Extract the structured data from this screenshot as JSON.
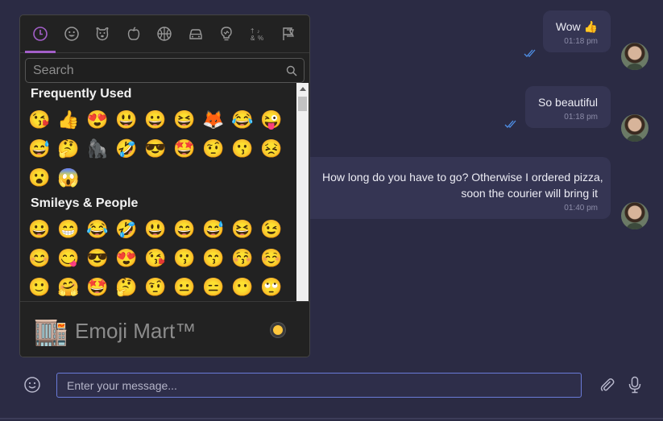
{
  "messages": [
    {
      "text": "Wow 👍",
      "time": "01:18 pm"
    },
    {
      "text": "So beautiful",
      "time": "01:18 pm"
    },
    {
      "line1": "How long do you have to go? Otherwise I ordered pizza,",
      "line2": "soon the courier will bring it",
      "time": "01:40 pm"
    }
  ],
  "picker": {
    "categories": [
      "recent-icon",
      "smileys-icon",
      "animals-icon",
      "food-icon",
      "activity-icon",
      "travel-icon",
      "objects-icon",
      "symbols-icon",
      "flags-icon"
    ],
    "search_placeholder": "Search",
    "sections": [
      {
        "title": "Frequently Used",
        "emojis": [
          "😘",
          "👍",
          "😍",
          "😃",
          "😀",
          "😆",
          "🦊",
          "😂",
          "😜",
          "😅",
          "🤔",
          "🦍",
          "🤣",
          "😎",
          "🤩",
          "🤨",
          "😗",
          "😣",
          "😮",
          "😱"
        ]
      },
      {
        "title": "Smileys & People",
        "emojis": [
          "😀",
          "😁",
          "😂",
          "🤣",
          "😃",
          "😄",
          "😅",
          "😆",
          "😉",
          "😊",
          "😋",
          "😎",
          "😍",
          "😘",
          "😗",
          "😙",
          "😚",
          "☺️",
          "🙂",
          "🤗",
          "🤩",
          "🤔",
          "🤨",
          "😐",
          "😑",
          "😶",
          "🙄"
        ]
      }
    ],
    "footer_emoji": "🏬",
    "footer_title": "Emoji Mart™",
    "skin_color": "#ffc83d",
    "accent": "#a35fc9"
  },
  "composer": {
    "placeholder": "Enter your message..."
  }
}
